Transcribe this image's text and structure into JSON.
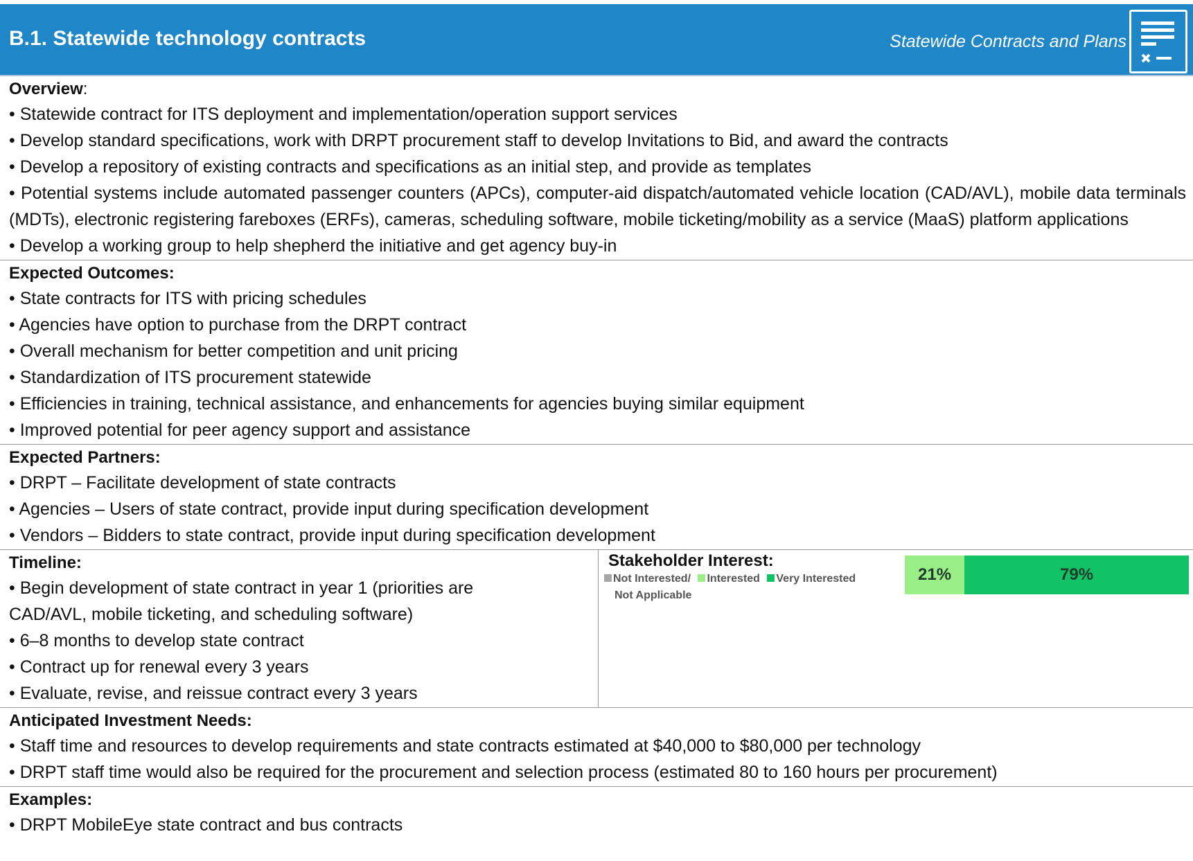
{
  "header": {
    "title": "B.1. Statewide technology contracts",
    "subtitle": "Statewide Contracts and Plans",
    "icon": "document-checklist-icon",
    "color": "#1f86c8"
  },
  "overview": {
    "label": "Overview",
    "colon": ":",
    "items": [
      "• Statewide contract for ITS deployment and implementation/operation support services",
      "• Develop standard specifications, work with DRPT procurement staff to develop Invitations to Bid, and award the contracts",
      "• Develop a repository of existing contracts and specifications as an initial step, and provide as templates",
      "• Potential systems include automated passenger counters (APCs), computer-aid dispatch/automated vehicle location (CAD/AVL), mobile data terminals (MDTs), electronic registering fareboxes (ERFs), cameras, scheduling software, mobile ticketing/mobility as a service (MaaS) platform applications",
      "• Develop a working group to help shepherd the initiative and get agency buy-in"
    ]
  },
  "outcomes": {
    "label": "Expected Outcomes:",
    "items": [
      "• State contracts for ITS with pricing schedules",
      "• Agencies have option to purchase from the DRPT contract",
      "• Overall mechanism for better competition and unit pricing",
      "• Standardization of ITS procurement statewide",
      "• Efficiencies in training, technical assistance, and enhancements for agencies buying similar equipment",
      "• Improved potential for peer agency support and assistance"
    ]
  },
  "partners": {
    "label": "Expected Partners:",
    "items": [
      "• DRPT – Facilitate development of state contracts",
      "• Agencies – Users of state contract, provide input during specification development",
      "• Vendors – Bidders to state contract, provide input during specification development"
    ]
  },
  "timeline": {
    "label": "Timeline:",
    "items": [
      "• Begin development of state contract in year 1 (priorities are",
      "CAD/AVL, mobile ticketing, and scheduling software)",
      "• 6–8 months to develop state contract",
      "• Contract up for renewal every 3 years",
      "• Evaluate, revise, and reissue contract every 3 years"
    ]
  },
  "stakeholder": {
    "label": "Stakeholder Interest:",
    "legend": [
      {
        "label": "Not Interested/",
        "color": "#a6a6a6"
      },
      {
        "label": "Interested",
        "color": "#99ee88"
      },
      {
        "label": "Very Interested",
        "color": "#11c266"
      }
    ],
    "legend_line2": "Not Applicable"
  },
  "chart_data": {
    "type": "bar",
    "orientation": "horizontal-stacked",
    "categories": [
      "Stakeholder Interest"
    ],
    "series": [
      {
        "name": "Not Interested/ Not Applicable",
        "values": [
          0
        ],
        "color": "#a6a6a6"
      },
      {
        "name": "Interested",
        "values": [
          21
        ],
        "color": "#99ee88",
        "label": "21%"
      },
      {
        "name": "Very Interested",
        "values": [
          79
        ],
        "color": "#11c266",
        "label": "79%"
      }
    ],
    "title": "Stakeholder Interest:",
    "legend": "top-left",
    "grid": false
  },
  "investment": {
    "label": "Anticipated Investment Needs:",
    "items": [
      "• Staff time and resources to develop requirements and state contracts estimated at $40,000 to $80,000 per technology",
      "• DRPT staff time would also be required for the procurement and selection process (estimated 80 to 160 hours per procurement)"
    ]
  },
  "examples": {
    "label": "Examples:",
    "items": [
      "• DRPT MobileEye state contract and bus contracts"
    ]
  }
}
